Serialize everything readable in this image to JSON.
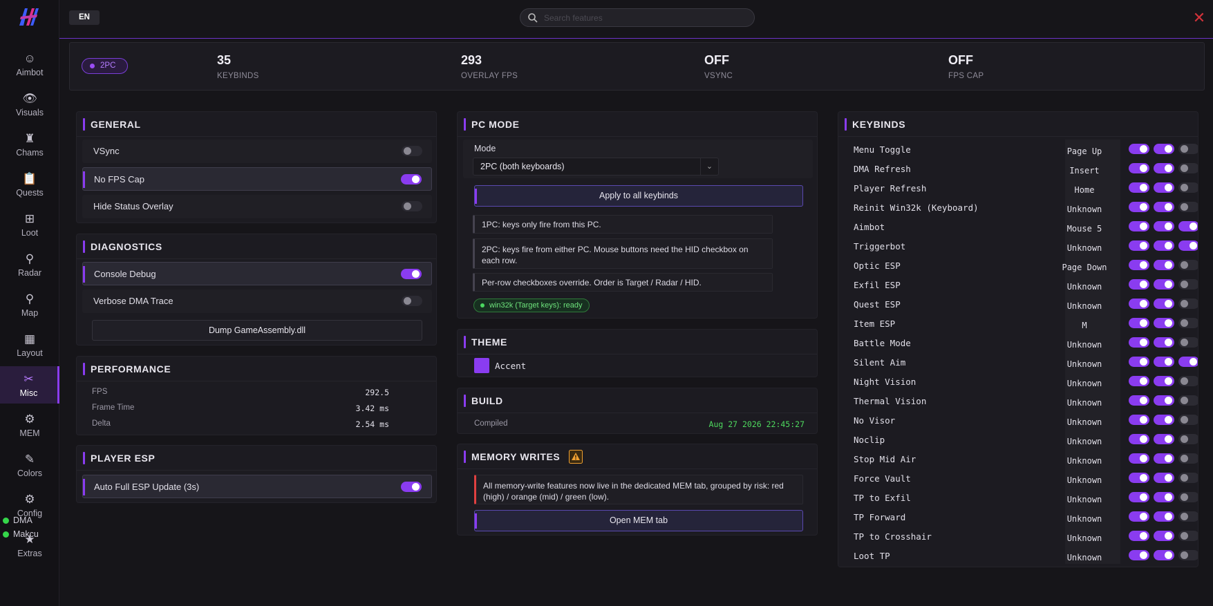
{
  "app": {
    "lang": "EN",
    "search_placeholder": "Search features"
  },
  "colors": {
    "accent": "#8a3cf0",
    "success": "#35d64a",
    "warning": "#f0a030",
    "danger": "#d2323a"
  },
  "nav": [
    {
      "label": "Aimbot",
      "icon": "smiley-icon"
    },
    {
      "label": "Visuals",
      "icon": "eye-icon"
    },
    {
      "label": "Chams",
      "icon": "person-icon"
    },
    {
      "label": "Quests",
      "icon": "clipboard-icon"
    },
    {
      "label": "Loot",
      "icon": "grid-icon"
    },
    {
      "label": "Radar",
      "icon": "radar-icon"
    },
    {
      "label": "Map",
      "icon": "map-pin-icon"
    },
    {
      "label": "Layout",
      "icon": "layout-icon"
    },
    {
      "label": "Misc",
      "icon": "tools-icon"
    },
    {
      "label": "MEM",
      "icon": "chip-icon"
    },
    {
      "label": "Colors",
      "icon": "eyedropper-icon"
    },
    {
      "label": "Config",
      "icon": "gear-icon"
    },
    {
      "label": "Extras",
      "icon": "star-icon"
    }
  ],
  "status": [
    {
      "label": "DMA"
    },
    {
      "label": "Makcu"
    }
  ],
  "stats": {
    "badge": "2PC",
    "items": [
      {
        "value": "35",
        "label": "KEYBINDS"
      },
      {
        "value": "293",
        "label": "OVERLAY FPS"
      },
      {
        "value": "OFF",
        "label": "VSYNC"
      },
      {
        "value": "OFF",
        "label": "FPS CAP"
      }
    ]
  },
  "general": {
    "title": "GENERAL",
    "rows": [
      {
        "label": "VSync",
        "on": false
      },
      {
        "label": "No FPS Cap",
        "on": true
      },
      {
        "label": "Hide Status Overlay",
        "on": false
      }
    ]
  },
  "diagnostics": {
    "title": "DIAGNOSTICS",
    "rows": [
      {
        "label": "Console Debug",
        "on": true
      },
      {
        "label": "Verbose DMA Trace",
        "on": false
      }
    ],
    "button": "Dump GameAssembly.dll"
  },
  "performance": {
    "title": "PERFORMANCE",
    "rows": [
      {
        "label": "FPS",
        "value": "292.5"
      },
      {
        "label": "Frame Time",
        "value": "3.42 ms"
      },
      {
        "label": "Delta",
        "value": "2.54 ms"
      }
    ]
  },
  "player_esp": {
    "title": "PLAYER ESP",
    "rows": [
      {
        "label": "Auto Full ESP Update (3s)",
        "on": true
      }
    ]
  },
  "pc_mode": {
    "title": "PC MODE",
    "mode_label": "Mode",
    "mode_value": "2PC (both keyboards)",
    "apply_button": "Apply to all keybinds",
    "notes": [
      "1PC: keys only fire from this PC.",
      "2PC: keys fire from either PC. Mouse buttons need the HID checkbox on each row.",
      "Per-row checkboxes override. Order is Target / Radar / HID."
    ],
    "status_pill": "win32k (Target keys): ready"
  },
  "theme": {
    "title": "THEME",
    "accent_label": "Accent"
  },
  "build": {
    "title": "BUILD",
    "compiled_label": "Compiled",
    "compiled_value": "Aug 27 2026 22:45:27"
  },
  "memory_writes": {
    "title": "MEMORY WRITES",
    "note": "All memory-write features now live in the dedicated MEM tab, grouped by risk: red (high) / orange (mid) / green (low).",
    "button": "Open MEM tab"
  },
  "keybinds": {
    "title": "KEYBINDS",
    "rows": [
      {
        "name": "Menu Toggle",
        "key": "Page Up",
        "t": [
          true,
          true,
          false
        ]
      },
      {
        "name": "DMA Refresh",
        "key": "Insert",
        "t": [
          true,
          true,
          false
        ]
      },
      {
        "name": "Player Refresh",
        "key": "Home",
        "t": [
          true,
          true,
          false
        ]
      },
      {
        "name": "Reinit Win32k (Keyboard)",
        "key": "Unknown",
        "t": [
          true,
          true,
          false
        ]
      },
      {
        "name": "Aimbot",
        "key": "Mouse 5",
        "t": [
          true,
          true,
          true
        ]
      },
      {
        "name": "Triggerbot",
        "key": "Unknown",
        "t": [
          true,
          true,
          true
        ]
      },
      {
        "name": "Optic ESP",
        "key": "Page Down",
        "t": [
          true,
          true,
          false
        ]
      },
      {
        "name": "Exfil ESP",
        "key": "Unknown",
        "t": [
          true,
          true,
          false
        ]
      },
      {
        "name": "Quest ESP",
        "key": "Unknown",
        "t": [
          true,
          true,
          false
        ]
      },
      {
        "name": "Item ESP",
        "key": "M",
        "t": [
          true,
          true,
          false
        ]
      },
      {
        "name": "Battle Mode",
        "key": "Unknown",
        "t": [
          true,
          true,
          false
        ]
      },
      {
        "name": "Silent Aim",
        "key": "Unknown",
        "t": [
          true,
          true,
          true
        ]
      },
      {
        "name": "Night Vision",
        "key": "Unknown",
        "t": [
          true,
          true,
          false
        ]
      },
      {
        "name": "Thermal Vision",
        "key": "Unknown",
        "t": [
          true,
          true,
          false
        ]
      },
      {
        "name": "No Visor",
        "key": "Unknown",
        "t": [
          true,
          true,
          false
        ]
      },
      {
        "name": "Noclip",
        "key": "Unknown",
        "t": [
          true,
          true,
          false
        ]
      },
      {
        "name": "Stop Mid Air",
        "key": "Unknown",
        "t": [
          true,
          true,
          false
        ]
      },
      {
        "name": "Force Vault",
        "key": "Unknown",
        "t": [
          true,
          true,
          false
        ]
      },
      {
        "name": "TP to Exfil",
        "key": "Unknown",
        "t": [
          true,
          true,
          false
        ]
      },
      {
        "name": "TP Forward",
        "key": "Unknown",
        "t": [
          true,
          true,
          false
        ]
      },
      {
        "name": "TP to Crosshair",
        "key": "Unknown",
        "t": [
          true,
          true,
          false
        ]
      },
      {
        "name": "Loot TP",
        "key": "Unknown",
        "t": [
          true,
          true,
          false
        ]
      }
    ]
  }
}
